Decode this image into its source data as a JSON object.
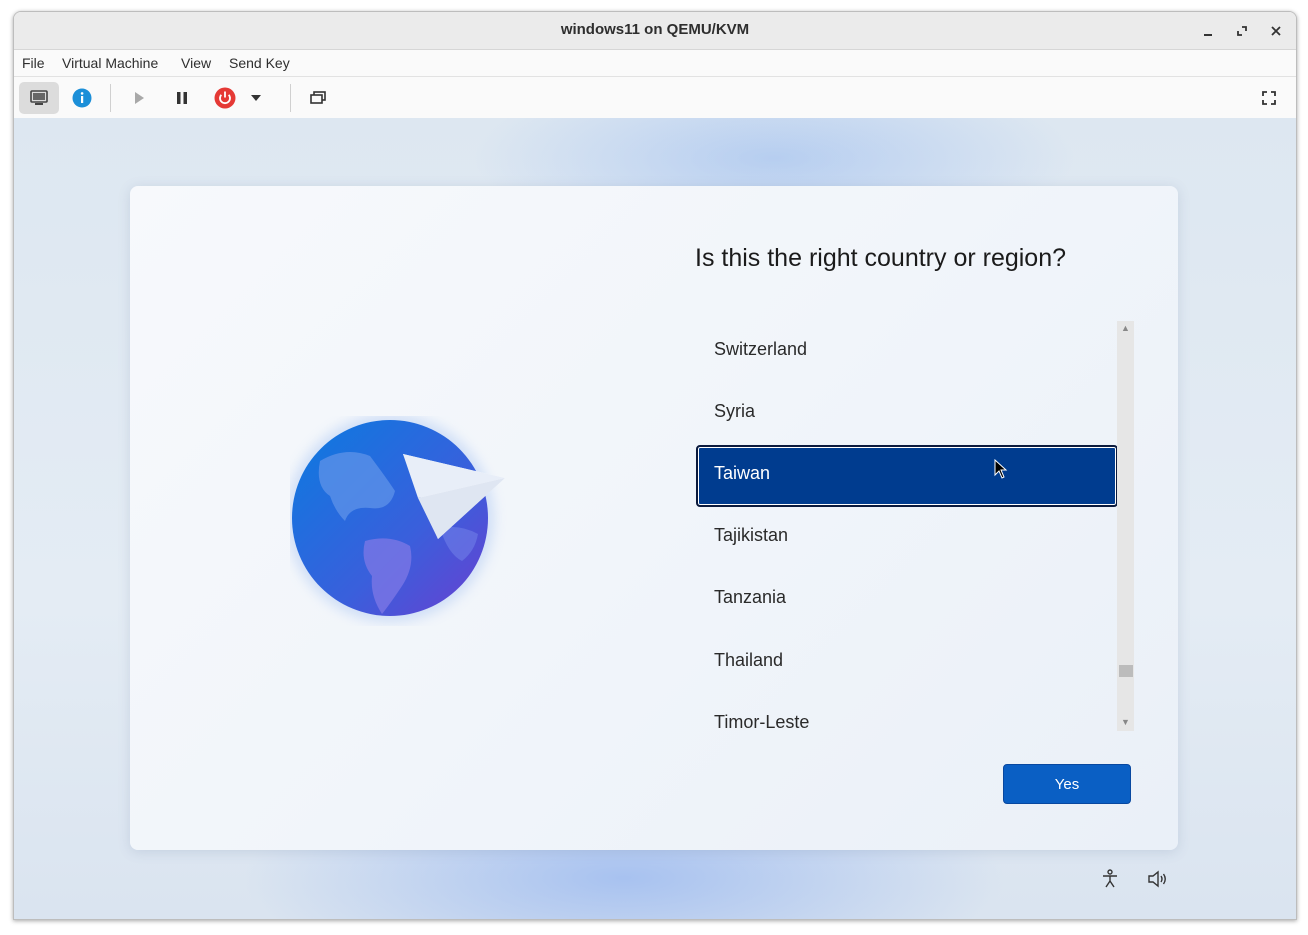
{
  "window": {
    "title": "windows11 on QEMU/KVM"
  },
  "menubar": {
    "items": [
      "File",
      "Virtual Machine",
      "View",
      "Send Key"
    ]
  },
  "toolbar": {
    "icons": [
      "console-icon",
      "info-icon",
      "play-icon",
      "pause-icon",
      "power-icon",
      "dropdown-icon",
      "snapshot-icon",
      "fullscreen-icon"
    ]
  },
  "oobe": {
    "question": "Is this the right country or region?",
    "countries": [
      "Switzerland",
      "Syria",
      "Taiwan",
      "Tajikistan",
      "Tanzania",
      "Thailand",
      "Timor-Leste"
    ],
    "selected": "Taiwan",
    "yes_label": "Yes"
  },
  "colors": {
    "selection": "#003c8f",
    "yes_button": "#0a5fc4",
    "power_icon": "#e53935",
    "info_icon": "#1c8fd8"
  }
}
